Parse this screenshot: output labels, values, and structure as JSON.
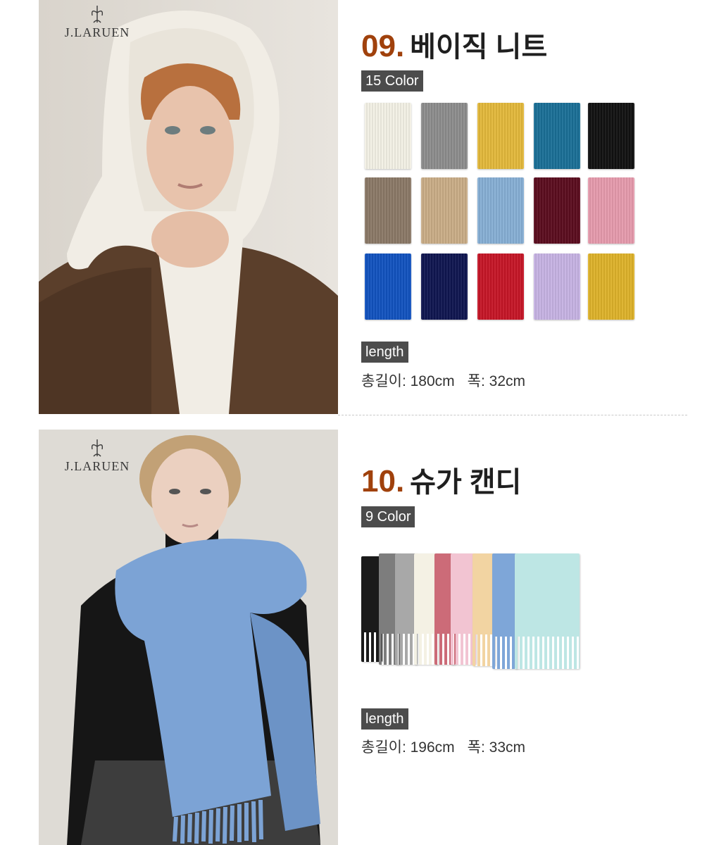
{
  "products": [
    {
      "brand": "J.LARUEN",
      "number": "09.",
      "name": "베이직 니트",
      "color_badge": "15 Color",
      "length_label": "length",
      "total_length": "총길이: 180cm",
      "width": "폭: 32cm",
      "swatch_colors": [
        "#f2f0e4",
        "#8c8c8c",
        "#e2b83a",
        "#1a6f96",
        "#111111",
        "#8a7866",
        "#c9ac86",
        "#86aed4",
        "#5a0c1e",
        "#e59aac",
        "#1152be",
        "#0f1550",
        "#c51526",
        "#c6b2e2",
        "#ddb129"
      ]
    },
    {
      "brand": "J.LARUEN",
      "number": "10.",
      "name": "슈가 캔디",
      "color_badge": "9 Color",
      "length_label": "length",
      "total_length": "총길이: 196cm",
      "width": "폭: 33cm",
      "swatch_colors": [
        "#1a1a1a",
        "#7d7d7d",
        "#a8a8a8",
        "#f4f1e4",
        "#cc6b78",
        "#f2c4d2",
        "#f2d4a2",
        "#7ea6d8",
        "#bde6e4"
      ]
    }
  ]
}
